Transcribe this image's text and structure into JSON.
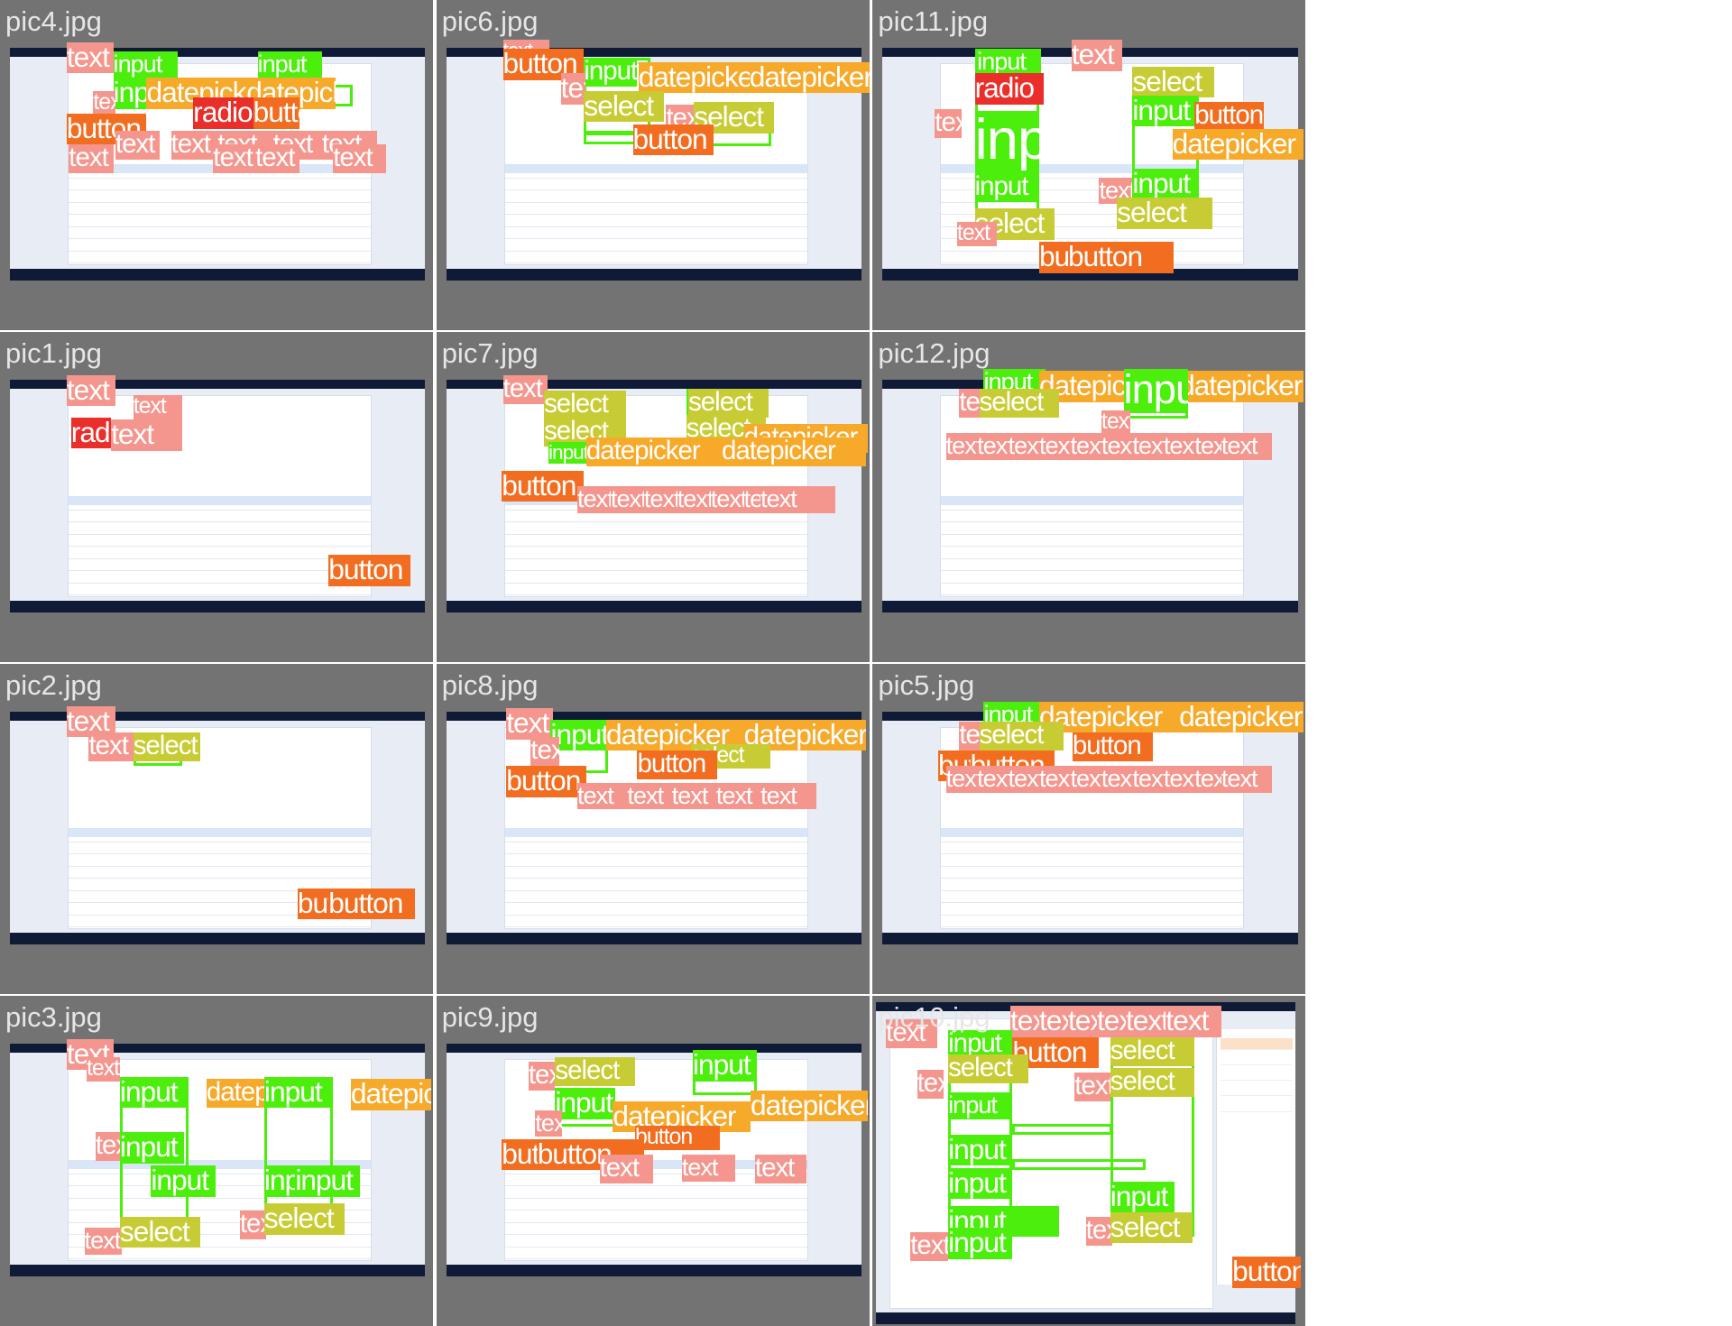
{
  "colors": {
    "text": "#f4968e",
    "input": "#4cef0c",
    "datepicker": "#f7a92a",
    "button": "#f26d1f",
    "select": "#c8cc34",
    "radio": "#ea2f2a",
    "background": "#737373",
    "screen_header": "#0f1b36"
  },
  "panels": [
    {
      "filename": "pic4.jpg",
      "annotations": [
        "text",
        "input",
        "input",
        "input",
        "datepicker",
        "datepicker",
        "text",
        "radio",
        "button",
        "button",
        "text",
        "text",
        "text",
        "text",
        "text",
        "text",
        "text",
        "text",
        "text"
      ]
    },
    {
      "filename": "pic6.jpg",
      "annotations": [
        "text",
        "button",
        "input",
        "datepicker",
        "datepicker",
        "text",
        "select",
        "text",
        "select",
        "button"
      ]
    },
    {
      "filename": "pic11.jpg",
      "annotations": [
        "input",
        "text",
        "radio",
        "select",
        "input",
        "button",
        "datepicker",
        "text",
        "input",
        "input",
        "text",
        "input",
        "select",
        "select",
        "text",
        "button",
        "button"
      ]
    },
    {
      "filename": "pic1.jpg",
      "annotations": [
        "text",
        "text",
        "radio",
        "text",
        "button"
      ]
    },
    {
      "filename": "pic7.jpg",
      "annotations": [
        "text",
        "select",
        "select",
        "select",
        "select",
        "datepicker",
        "input",
        "datepicker",
        "datepicker",
        "button",
        "text",
        "text",
        "text",
        "text",
        "text",
        "text",
        "text"
      ]
    },
    {
      "filename": "pic12.jpg",
      "annotations": [
        "input",
        "datepicker",
        "datepicker",
        "text",
        "select",
        "input",
        "text",
        "text",
        "text",
        "text",
        "text",
        "text",
        "text",
        "text",
        "text",
        "text",
        "text"
      ]
    },
    {
      "filename": "pic2.jpg",
      "annotations": [
        "text",
        "text",
        "select",
        "button",
        "button"
      ]
    },
    {
      "filename": "pic8.jpg",
      "annotations": [
        "text",
        "input",
        "datepicker",
        "datepicker",
        "text",
        "select",
        "button",
        "button",
        "text",
        "text",
        "text",
        "text",
        "text"
      ]
    },
    {
      "filename": "pic5.jpg",
      "annotations": [
        "input",
        "datepicker",
        "datepicker",
        "text",
        "select",
        "button",
        "button",
        "button",
        "text",
        "text",
        "text",
        "text",
        "text",
        "text",
        "text",
        "text",
        "text",
        "text"
      ]
    },
    {
      "filename": "pic3.jpg",
      "annotations": [
        "text",
        "text",
        "input",
        "datepicker",
        "input",
        "datepicker",
        "text",
        "input",
        "input",
        "input",
        "input",
        "text",
        "select",
        "text",
        "select"
      ]
    },
    {
      "filename": "pic9.jpg",
      "annotations": [
        "input",
        "text",
        "select",
        "input",
        "text",
        "datepicker",
        "datepicker",
        "button",
        "button",
        "button",
        "text",
        "text",
        "text"
      ]
    },
    {
      "filename": "pic10.jpg",
      "annotations": [
        "text",
        "text",
        "text",
        "text",
        "text",
        "text",
        "text",
        "input",
        "button",
        "select",
        "text",
        "select",
        "text",
        "select",
        "input",
        "input",
        "input",
        "input",
        "text",
        "select",
        "input",
        "input",
        "text",
        "button"
      ]
    }
  ]
}
